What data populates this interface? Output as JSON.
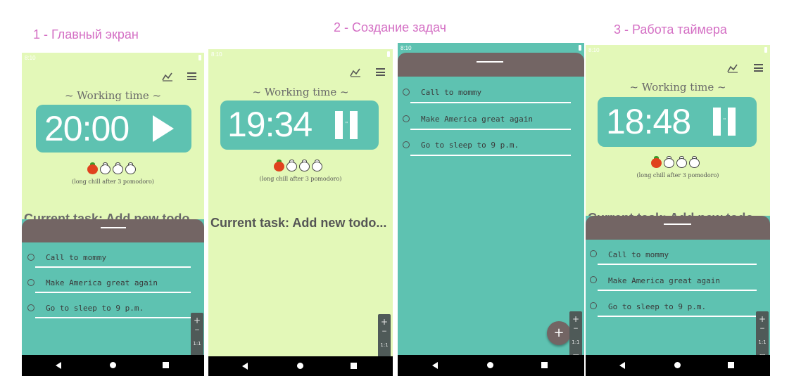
{
  "captions": {
    "c1": "1 - Главный экран",
    "c2": "2 - Создание задач",
    "c3": "3 - Работа таймера"
  },
  "status_time": "8:10",
  "mode_title": "~ Working time ~",
  "screens": {
    "s1": {
      "timer": "20:00",
      "control": "play-icon"
    },
    "s2": {
      "timer": "19:34",
      "control": "pause-icon"
    },
    "s4": {
      "timer": "18:48",
      "control": "pause-icon"
    }
  },
  "pomodoro": {
    "filled": 1,
    "total": 4,
    "note": "(long chill after 3 pomodoro)"
  },
  "current_task_label": "Current task: Add new todo...",
  "todos": [
    "Call to mommy",
    "Make America great again",
    "Go to sleep to 9 p.m."
  ],
  "zoom_controls": {
    "plus": "+",
    "minus": "−",
    "ratio": "1:1"
  },
  "fab_label": "+",
  "colors": {
    "background": "#e3f8b8",
    "accent": "#5ec2b1",
    "sheet_header": "#736564",
    "caption": "#d46fc4",
    "tomato": "#e0421e"
  }
}
